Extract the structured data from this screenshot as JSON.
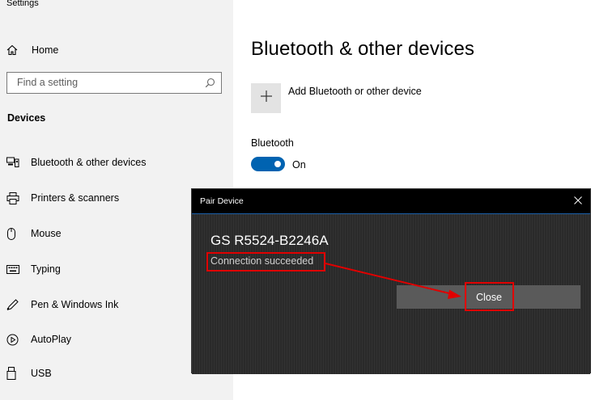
{
  "window": {
    "title": "Settings"
  },
  "sidebar": {
    "home_label": "Home",
    "search_placeholder": "Find a setting",
    "section_heading": "Devices",
    "items": [
      {
        "label": "Bluetooth & other devices",
        "icon": "bluetooth-devices-icon"
      },
      {
        "label": "Printers & scanners",
        "icon": "printer-icon"
      },
      {
        "label": "Mouse",
        "icon": "mouse-icon"
      },
      {
        "label": "Typing",
        "icon": "keyboard-icon"
      },
      {
        "label": "Pen & Windows Ink",
        "icon": "pen-icon"
      },
      {
        "label": "AutoPlay",
        "icon": "autoplay-icon"
      },
      {
        "label": "USB",
        "icon": "usb-icon"
      }
    ]
  },
  "main": {
    "title": "Bluetooth & other devices",
    "add_device_label": "Add Bluetooth or other device",
    "bluetooth_label": "Bluetooth",
    "toggle_state": "On"
  },
  "dialog": {
    "title": "Pair Device",
    "device_name": "GS R5524-B2246A",
    "status": "Connection succeeded",
    "close_label": "Close"
  },
  "colors": {
    "accent": "#0063b1",
    "highlight": "#e00000",
    "dialog_bg": "#2b2b2b"
  }
}
